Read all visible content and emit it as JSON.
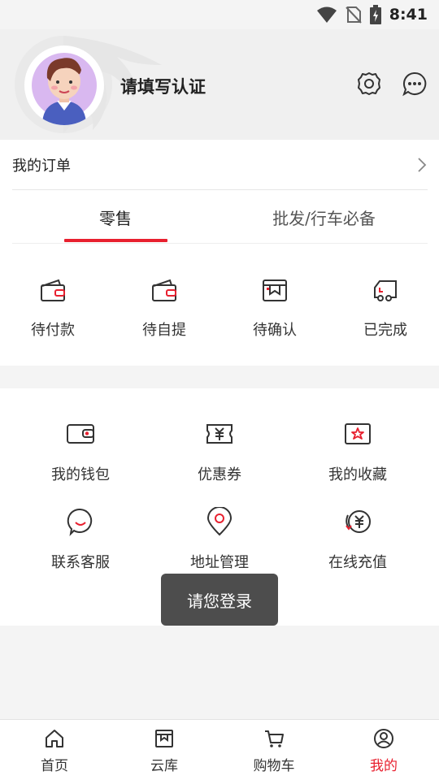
{
  "status_bar": {
    "time": "8:41"
  },
  "profile": {
    "name": "请填写认证"
  },
  "orders": {
    "title": "我的订单",
    "tabs": [
      {
        "label": "零售"
      },
      {
        "label": "批发/行车必备"
      }
    ],
    "statuses": [
      {
        "label": "待付款",
        "icon": "wallet-icon"
      },
      {
        "label": "待自提",
        "icon": "wallet-icon"
      },
      {
        "label": "待确认",
        "icon": "package-icon"
      },
      {
        "label": "已完成",
        "icon": "truck-icon"
      }
    ]
  },
  "services": [
    {
      "label": "我的钱包",
      "icon": "wallet-icon"
    },
    {
      "label": "优惠券",
      "icon": "coupon-icon"
    },
    {
      "label": "我的收藏",
      "icon": "star-icon"
    },
    {
      "label": "联系客服",
      "icon": "chat-icon"
    },
    {
      "label": "地址管理",
      "icon": "location-icon"
    },
    {
      "label": "在线充值",
      "icon": "recharge-icon"
    }
  ],
  "toast": {
    "text": "请您登录"
  },
  "bottom_nav": [
    {
      "label": "首页",
      "icon": "home-icon"
    },
    {
      "label": "云库",
      "icon": "box-icon"
    },
    {
      "label": "购物车",
      "icon": "cart-icon"
    },
    {
      "label": "我的",
      "icon": "user-icon",
      "active": true
    }
  ],
  "colors": {
    "accent": "#e8202f",
    "avatar_bg": "#d9b8f0"
  }
}
